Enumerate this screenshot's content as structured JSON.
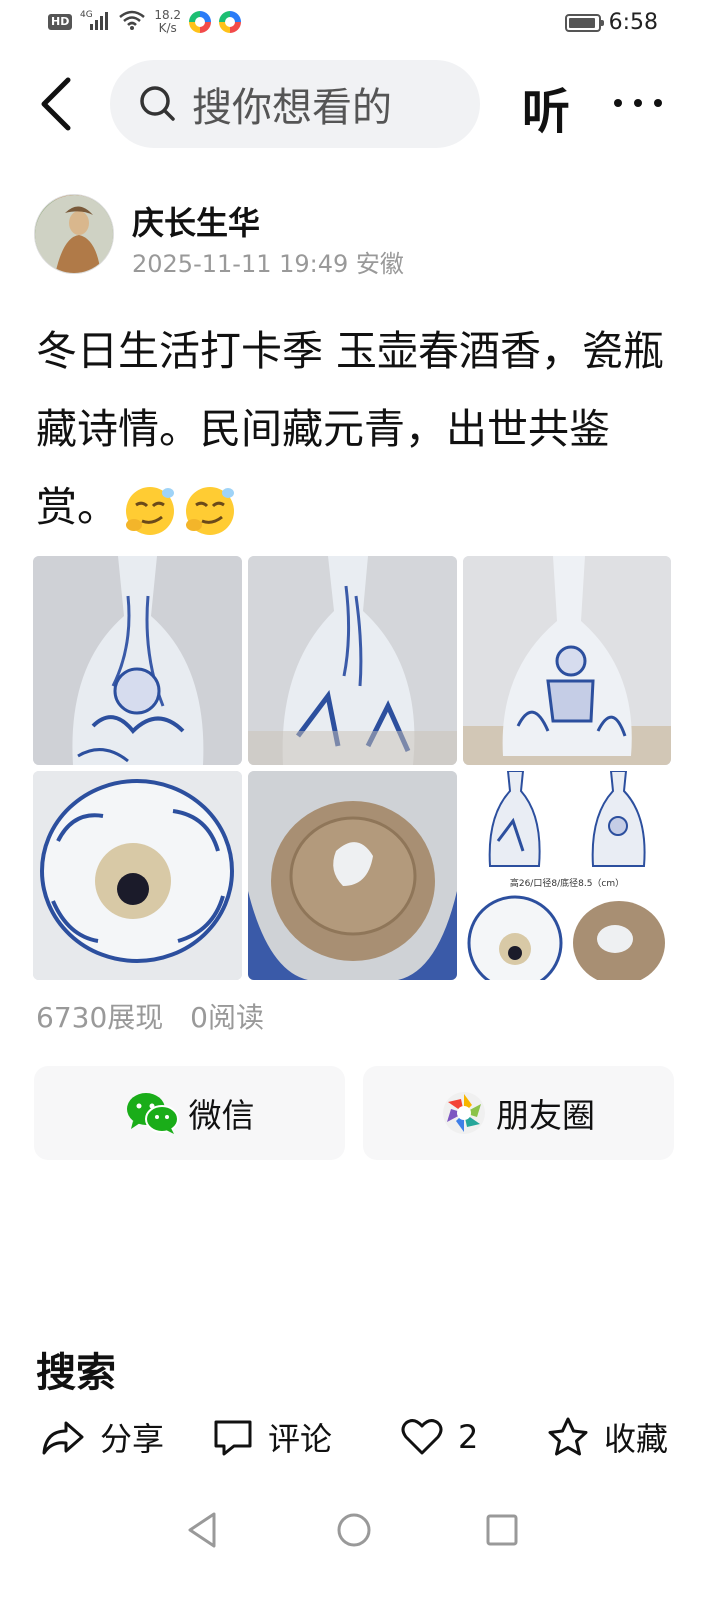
{
  "status_bar": {
    "hd": "HD",
    "network": "4G",
    "speed_value": "18.2",
    "speed_unit": "K/s",
    "time": "6:58"
  },
  "topnav": {
    "search_placeholder": "搜你想看的",
    "listen_label": "听"
  },
  "author": {
    "name": "庆长生华",
    "meta": "2025-11-11 19:49 安徽"
  },
  "post": {
    "text": "冬日生活打卡季 玉壶春酒香，瓷瓶藏诗情。民间藏元青，出世共鉴赏。"
  },
  "images": {
    "caption_6": "高26/口径8/底径8.5（cm）"
  },
  "stats": {
    "impressions": "6730展现",
    "reads": "0阅读"
  },
  "share": {
    "wechat_label": "微信",
    "moments_label": "朋友圈"
  },
  "section": {
    "title": "搜索"
  },
  "actions": {
    "share_label": "分享",
    "comment_label": "评论",
    "like_count": "2",
    "favorite_label": "收藏"
  },
  "colors": {
    "wechat_green": "#1aad19",
    "placeholder_gray": "#999999",
    "search_bg": "#f1f2f4",
    "porcelain_blue": "#2c4f9e"
  }
}
